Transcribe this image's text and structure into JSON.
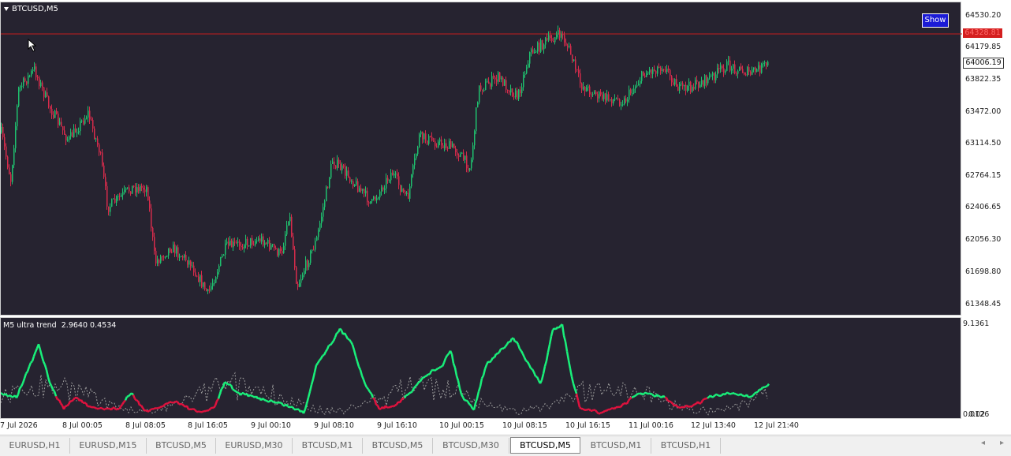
{
  "chart": {
    "symbol_title": "BTCUSD,M5",
    "show_button": "Show",
    "price_axis": [
      "64530.20",
      "64179.85",
      "63822.35",
      "63472.00",
      "63114.50",
      "62764.15",
      "62406.65",
      "62056.30",
      "61698.80",
      "61348.45"
    ],
    "horizontal_line_price": "64328.81",
    "current_price": "64006.19",
    "time_axis": [
      "7 Jul 2026",
      "8 Jul 00:05",
      "8 Jul 08:05",
      "8 Jul 16:05",
      "9 Jul 00:10",
      "9 Jul 08:10",
      "9 Jul 16:10",
      "10 Jul 00:15",
      "10 Jul 08:15",
      "10 Jul 16:15",
      "11 Jul 00:16",
      "12 Jul 13:40",
      "12 Jul 21:40"
    ],
    "colors": {
      "background": "#262330",
      "bull": "#1fbf6e",
      "bear": "#d62b4b",
      "level_line": "#c41e1e"
    }
  },
  "indicator": {
    "title": "M5 ultra trend",
    "value1": "2.9640",
    "value2": "0.4534",
    "scale_top": "9.1361",
    "scale_bottom_a": "0.0126",
    "scale_bottom_b": "0.02",
    "colors": {
      "up": "#19f07a",
      "down": "#e0123e",
      "dotted": "#9a9a9a"
    }
  },
  "tabs": [
    {
      "label": "EURUSD,H1",
      "active": false
    },
    {
      "label": "EURUSD,M15",
      "active": false
    },
    {
      "label": "BTCUSD,M5",
      "active": false
    },
    {
      "label": "EURUSD,M30",
      "active": false
    },
    {
      "label": "BTCUSD,M1",
      "active": false
    },
    {
      "label": "BTCUSD,M5",
      "active": false
    },
    {
      "label": "BTCUSD,M30",
      "active": false
    },
    {
      "label": "BTCUSD,M5",
      "active": true
    },
    {
      "label": "BTCUSD,M1",
      "active": false
    },
    {
      "label": "BTCUSD,H1",
      "active": false
    }
  ],
  "nav": {
    "left": "◂",
    "right": "▸"
  }
}
